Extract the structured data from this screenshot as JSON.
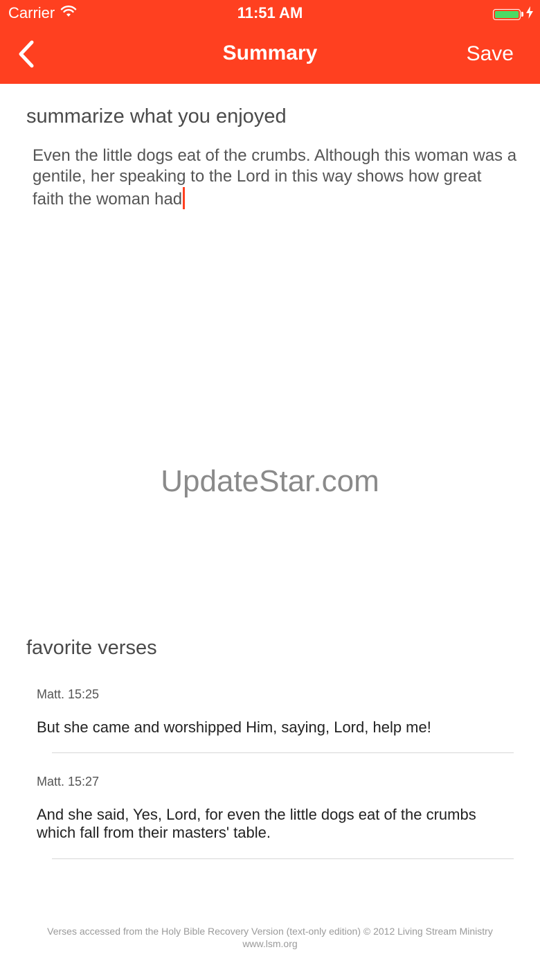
{
  "status_bar": {
    "carrier": "Carrier",
    "time": "11:51 AM"
  },
  "nav": {
    "title": "Summary",
    "save_label": "Save"
  },
  "summary": {
    "heading": "summarize what you enjoyed",
    "text": "Even the little dogs eat of the crumbs. Although this woman was a gentile, her speaking to the Lord in this way shows how great faith the woman had"
  },
  "watermark": "UpdateStar.com",
  "favorites": {
    "heading": "favorite verses",
    "verses": [
      {
        "ref": "Matt. 15:25",
        "text": "But she came and worshipped Him, saying, Lord, help me!"
      },
      {
        "ref": "Matt. 15:27",
        "text": "And she said, Yes, Lord, for even the little dogs eat of the crumbs which fall from their masters' table."
      }
    ]
  },
  "footer": "Verses accessed from the Holy Bible Recovery Version (text-only edition) © 2012 Living Stream Ministry www.lsm.org",
  "colors": {
    "accent": "#ff4020",
    "battery": "#4cd964"
  },
  "icons": {
    "back": "chevron-left-icon",
    "wifi": "wifi-icon",
    "battery": "battery-icon",
    "charging": "bolt-icon"
  }
}
